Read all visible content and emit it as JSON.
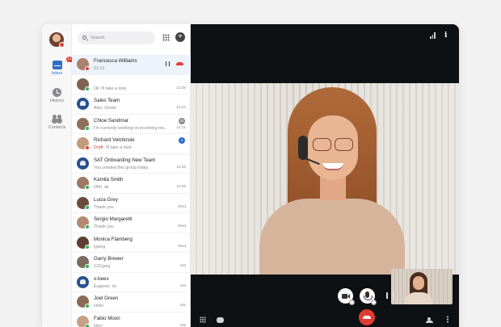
{
  "rail": {
    "inbox_label": "Inbox",
    "inbox_badge": "17",
    "history_label": "History",
    "contacts_label": "Contacts"
  },
  "search": {
    "placeholder": "Search"
  },
  "conversations": [
    {
      "name": "Francesca Williams",
      "preview": "01:12",
      "time": "",
      "status": "busy",
      "active": true
    },
    {
      "name": "",
      "preview": "Ok I'll take a look",
      "time": "12:38",
      "status": "online"
    },
    {
      "name": "Sales Team",
      "preview": "Alex: Great!",
      "time": "12:22",
      "status": "team"
    },
    {
      "name": "Chloe Sandmar",
      "preview": "I'm currently working on incoming me...",
      "time": "12:11",
      "status": "online",
      "badge": "22",
      "badge_color": "#8a8a8e"
    },
    {
      "name": "Richard Velchinski",
      "preview": "I'll take a look",
      "draft": "Draft:",
      "time": "",
      "status": "busy",
      "badge": "1",
      "badge_color": "#2f6dc9"
    },
    {
      "name": "SAT Onboarding New Team",
      "preview": "You created this group today.",
      "time": "11:08",
      "status": "team"
    },
    {
      "name": "Kamila Smith",
      "preview": "Ohh, ok",
      "time": "11:08",
      "status": "online"
    },
    {
      "name": "Lucia Grey",
      "preview": "Thank you",
      "time": "Wed",
      "status": "online"
    },
    {
      "name": "Sergio Margaretti",
      "preview": "Thank you",
      "time": "Wed",
      "status": "online"
    },
    {
      "name": "Monica Flamberg",
      "preview": "typing",
      "time": "Wed",
      "status": "online"
    },
    {
      "name": "Garry Brewer",
      "preview": "123.jpeg",
      "time": "Sat",
      "status": "online"
    },
    {
      "name": "x-bees",
      "preview": "Eugenie: ok",
      "time": "Sat",
      "status": "team"
    },
    {
      "name": "Joel Green",
      "preview": "Hello",
      "time": "Sat",
      "status": "online"
    },
    {
      "name": "Fabio Moon",
      "preview": "Hey!",
      "time": "Sat",
      "status": "online"
    }
  ],
  "colors": {
    "accent": "#2f6dc9",
    "hangup": "#e03c31",
    "online": "#2cb35a",
    "video_bg": "#0e1113"
  }
}
